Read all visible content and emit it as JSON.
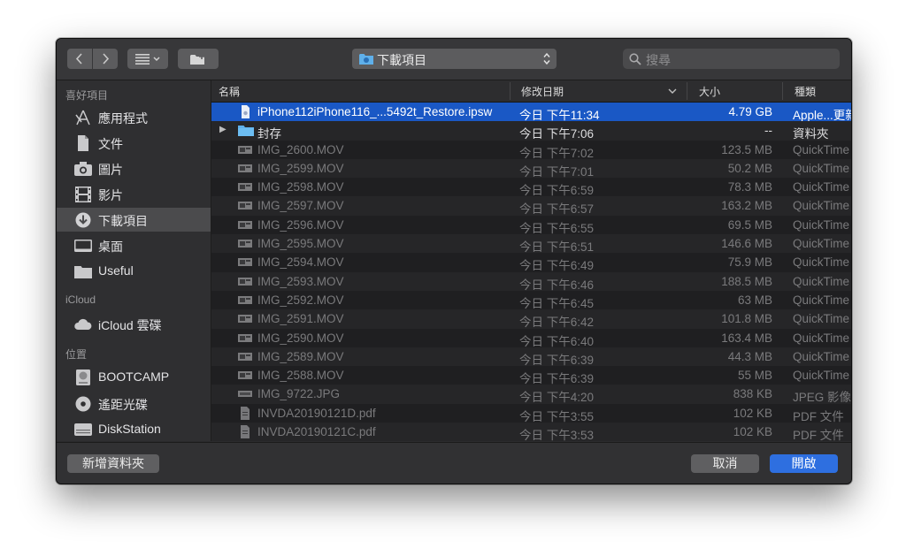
{
  "toolbar": {
    "location_label": "下載項目",
    "search_placeholder": "搜尋"
  },
  "sidebar": {
    "favorites_header": "喜好項目",
    "icloud_header": "iCloud",
    "locations_header": "位置",
    "favorites": [
      {
        "label": "應用程式",
        "icon": "apps-icon"
      },
      {
        "label": "文件",
        "icon": "document-icon"
      },
      {
        "label": "圖片",
        "icon": "camera-icon"
      },
      {
        "label": "影片",
        "icon": "film-icon"
      },
      {
        "label": "下載項目",
        "icon": "download-icon",
        "selected": true
      },
      {
        "label": "桌面",
        "icon": "desktop-icon"
      },
      {
        "label": "Useful",
        "icon": "folder-icon"
      }
    ],
    "icloud": [
      {
        "label": "iCloud 雲碟",
        "icon": "cloud-icon"
      }
    ],
    "locations": [
      {
        "label": "BOOTCAMP",
        "icon": "disk-icon"
      },
      {
        "label": "遙距光碟",
        "icon": "disc-icon"
      },
      {
        "label": "DiskStation",
        "icon": "server-icon"
      }
    ]
  },
  "columns": {
    "name": "名稱",
    "date": "修改日期",
    "size": "大小",
    "kind": "種類"
  },
  "files": [
    {
      "name": "iPhone112iPhone116_...5492t_Restore.ipsw",
      "date": "今日 下午11:34",
      "size": "4.79 GB",
      "kind": "Apple...更新",
      "icon": "ipsw-file-icon",
      "selected": true
    },
    {
      "name": "封存",
      "date": "今日 下午7:06",
      "size": "--",
      "kind": "資料夾",
      "icon": "folder-icon",
      "folder": true
    },
    {
      "name": "IMG_2600.MOV",
      "date": "今日 下午7:02",
      "size": "123.5 MB",
      "kind": "QuickTime",
      "icon": "movie-file-icon"
    },
    {
      "name": "IMG_2599.MOV",
      "date": "今日 下午7:01",
      "size": "50.2 MB",
      "kind": "QuickTime",
      "icon": "movie-file-icon"
    },
    {
      "name": "IMG_2598.MOV",
      "date": "今日 下午6:59",
      "size": "78.3 MB",
      "kind": "QuickTime",
      "icon": "movie-file-icon"
    },
    {
      "name": "IMG_2597.MOV",
      "date": "今日 下午6:57",
      "size": "163.2 MB",
      "kind": "QuickTime",
      "icon": "movie-file-icon"
    },
    {
      "name": "IMG_2596.MOV",
      "date": "今日 下午6:55",
      "size": "69.5 MB",
      "kind": "QuickTime",
      "icon": "movie-file-icon"
    },
    {
      "name": "IMG_2595.MOV",
      "date": "今日 下午6:51",
      "size": "146.6 MB",
      "kind": "QuickTime",
      "icon": "movie-file-icon"
    },
    {
      "name": "IMG_2594.MOV",
      "date": "今日 下午6:49",
      "size": "75.9 MB",
      "kind": "QuickTime",
      "icon": "movie-file-icon"
    },
    {
      "name": "IMG_2593.MOV",
      "date": "今日 下午6:46",
      "size": "188.5 MB",
      "kind": "QuickTime",
      "icon": "movie-file-icon"
    },
    {
      "name": "IMG_2592.MOV",
      "date": "今日 下午6:45",
      "size": "63 MB",
      "kind": "QuickTime",
      "icon": "movie-file-icon"
    },
    {
      "name": "IMG_2591.MOV",
      "date": "今日 下午6:42",
      "size": "101.8 MB",
      "kind": "QuickTime",
      "icon": "movie-file-icon"
    },
    {
      "name": "IMG_2590.MOV",
      "date": "今日 下午6:40",
      "size": "163.4 MB",
      "kind": "QuickTime",
      "icon": "movie-file-icon"
    },
    {
      "name": "IMG_2589.MOV",
      "date": "今日 下午6:39",
      "size": "44.3 MB",
      "kind": "QuickTime",
      "icon": "movie-file-icon"
    },
    {
      "name": "IMG_2588.MOV",
      "date": "今日 下午6:39",
      "size": "55 MB",
      "kind": "QuickTime",
      "icon": "movie-file-icon"
    },
    {
      "name": "IMG_9722.JPG",
      "date": "今日 下午4:20",
      "size": "838 KB",
      "kind": "JPEG 影像",
      "icon": "image-file-icon"
    },
    {
      "name": "INVDA20190121D.pdf",
      "date": "今日 下午3:55",
      "size": "102 KB",
      "kind": "PDF 文件",
      "icon": "pdf-file-icon"
    },
    {
      "name": "INVDA20190121C.pdf",
      "date": "今日 下午3:53",
      "size": "102 KB",
      "kind": "PDF 文件",
      "icon": "pdf-file-icon"
    }
  ],
  "buttons": {
    "new_folder": "新增資料夾",
    "cancel": "取消",
    "open": "開啟"
  }
}
